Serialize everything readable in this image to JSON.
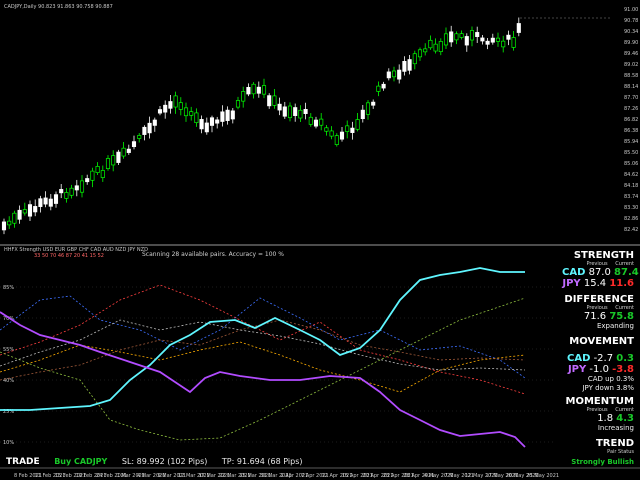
{
  "chart_header": "CADJPY,Daily  90.823 91.863 90.758 90.887",
  "indicator_header": "HHFX Strength  USD EUR GBP CHF CAD AUD NZD JPY  NZD",
  "indicator_values": "33  50  70  46  87  20  41  15  52",
  "scanning": "Scanning 28 available pairs. Accuracy = 100 %",
  "price_levels": [
    "91.00",
    "90.78",
    "90.34",
    "89.90",
    "89.46",
    "89.02",
    "88.58",
    "88.14",
    "87.70",
    "87.26",
    "86.82",
    "86.38",
    "85.94",
    "85.50",
    "85.06",
    "84.62",
    "84.18",
    "83.74",
    "83.30",
    "82.86",
    "82.42"
  ],
  "indicator_levels": [
    "85%",
    "70%",
    "55%",
    "40%",
    "25%",
    "10%"
  ],
  "dates": [
    "8 Feb 2021",
    "11 Feb 2021",
    "15 Feb 2021",
    "19 Feb 2021",
    "24 Feb 2021",
    "1 Mar 2021",
    "4 Mar 2021",
    "9 Mar 2021",
    "12 Mar 2021",
    "17 Mar 2021",
    "22 Mar 2021",
    "25 Mar 2021",
    "30 Mar 2021",
    "2 Apr 2021",
    "7 Apr 2021",
    "12 Apr 2021",
    "15 Apr 2021",
    "20 Apr 2021",
    "23 Apr 2021",
    "28 Apr 2021",
    "4 May 2021",
    "7 May 2021",
    "12 May 2021",
    "17 May 2021",
    "20 May 2021",
    "25 May 2021"
  ],
  "strength": {
    "title": "STRENGTH",
    "col_prev": "Previous",
    "col_curr": "Current",
    "rows": [
      {
        "pair": "CAD",
        "prev": "87.0",
        "curr": "87.4"
      },
      {
        "pair": "JPY",
        "prev": "15.4",
        "curr": "11.6"
      }
    ]
  },
  "difference": {
    "title": "DIFFERENCE",
    "col_prev": "Previous",
    "col_curr": "Current",
    "prev": "71.6",
    "curr": "75.8",
    "status": "Expanding"
  },
  "movement": {
    "title": "MOVEMENT",
    "rows": [
      {
        "pair": "CAD",
        "prev": "-2.7",
        "curr": "0.3"
      },
      {
        "pair": "JPY",
        "prev": "-1.0",
        "curr": "-3.8"
      }
    ],
    "note1": "CAD up 0.3%",
    "note2": "JPY down 3.8%"
  },
  "momentum": {
    "title": "MOMENTUM",
    "col_prev": "Previous",
    "col_curr": "Current",
    "prev": "1.8",
    "curr": "4.3",
    "status": "Increasing"
  },
  "trend": {
    "title": "TREND",
    "sub": "Pair Status",
    "status": "Strongly Bullish"
  },
  "bottom": {
    "trade": "TRADE",
    "signal": "Buy CADJPY",
    "sl": "SL: 89.992 (102 Pips)",
    "tp": "TP: 91.694 (68 Pips)"
  },
  "colors": {
    "bull": "#00ff00",
    "bear": "#ffffff",
    "cad": "#5ff6ff",
    "jpy": "#b24cff",
    "separator": "#9a9a9a",
    "green_text": "#19c829",
    "red_text": "#ff2a2a"
  }
}
